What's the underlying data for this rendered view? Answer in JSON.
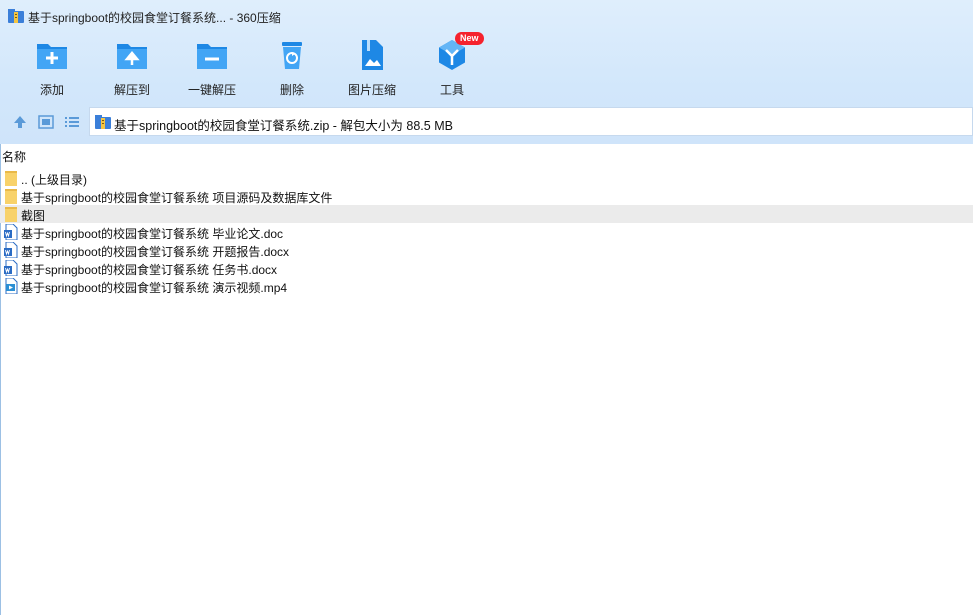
{
  "window": {
    "title": "基于springboot的校园食堂订餐系统... - 360压缩"
  },
  "toolbar": {
    "items": [
      {
        "label": "添加"
      },
      {
        "label": "解压到"
      },
      {
        "label": "一键解压"
      },
      {
        "label": "删除"
      },
      {
        "label": "图片压缩"
      },
      {
        "label": "工具"
      }
    ],
    "new_badge": "New"
  },
  "address": {
    "text": "基于springboot的校园食堂订餐系统.zip - 解包大小为 88.5 MB"
  },
  "list": {
    "column_name": "名称",
    "rows": [
      {
        "name": ".. (上级目录)",
        "type": "folder"
      },
      {
        "name": "基于springboot的校园食堂订餐系统 项目源码及数据库文件",
        "type": "folder"
      },
      {
        "name": "截图",
        "type": "folder",
        "selected": true
      },
      {
        "name": "基于springboot的校园食堂订餐系统 毕业论文.doc",
        "type": "word"
      },
      {
        "name": "基于springboot的校园食堂订餐系统 开题报告.docx",
        "type": "word"
      },
      {
        "name": "基于springboot的校园食堂订餐系统 任务书.docx",
        "type": "word"
      },
      {
        "name": "基于springboot的校园食堂订餐系统 演示视频.mp4",
        "type": "video"
      }
    ]
  }
}
